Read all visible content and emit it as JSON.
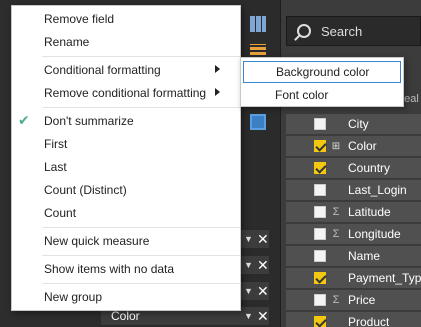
{
  "context_menu": {
    "items": [
      {
        "label": "Remove field"
      },
      {
        "label": "Rename"
      },
      {
        "label": "Conditional formatting",
        "has_submenu": true
      },
      {
        "label": "Remove conditional formatting",
        "has_submenu": true
      },
      {
        "label": "Don't summarize",
        "checked": true
      },
      {
        "label": "First"
      },
      {
        "label": "Last"
      },
      {
        "label": "Count (Distinct)"
      },
      {
        "label": "Count"
      },
      {
        "label": "New quick measure"
      },
      {
        "label": "Show items with no data"
      },
      {
        "label": "New group"
      }
    ]
  },
  "submenu": {
    "items": [
      {
        "label": "Background color",
        "highlighted": true
      },
      {
        "label": "Font color"
      }
    ]
  },
  "search": {
    "placeholder": "Search"
  },
  "fields_header_partial": "ireal",
  "fields": [
    {
      "name": "City",
      "checked": false,
      "sigma": false
    },
    {
      "name": "Color",
      "checked": true,
      "sigma": false,
      "hierarchy": true
    },
    {
      "name": "Country",
      "checked": true,
      "sigma": false
    },
    {
      "name": "Last_Login",
      "checked": false,
      "sigma": false
    },
    {
      "name": "Latitude",
      "checked": false,
      "sigma": true
    },
    {
      "name": "Longitude",
      "checked": false,
      "sigma": true
    },
    {
      "name": "Name",
      "checked": false,
      "sigma": false
    },
    {
      "name": "Payment_Type",
      "checked": true,
      "sigma": false
    },
    {
      "name": "Price",
      "checked": false,
      "sigma": true
    },
    {
      "name": "Product",
      "checked": true,
      "sigma": false
    }
  ],
  "values_well": {
    "color_field": "Color"
  },
  "colors": {
    "accent_yellow": "#f2c811",
    "check_green": "#4caf8a",
    "highlight_border": "#3a85d4"
  }
}
